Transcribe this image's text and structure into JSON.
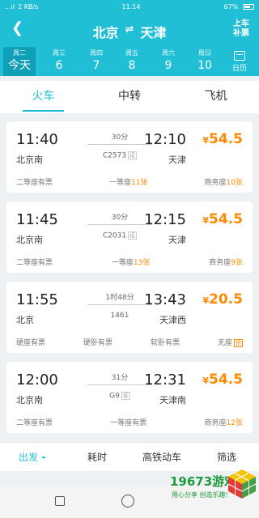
{
  "statusbar": {
    "signal": "...ıl",
    "speed": "2 KB/s",
    "time": "11:14",
    "battery": "67%"
  },
  "header": {
    "from": "北京",
    "to": "天津",
    "swap": "⇌",
    "bupiao": "上车补票"
  },
  "dates": [
    {
      "week": "周二",
      "day": "今天",
      "selected": true
    },
    {
      "week": "周三",
      "day": "6"
    },
    {
      "week": "周四",
      "day": "7"
    },
    {
      "week": "周五",
      "day": "8"
    },
    {
      "week": "周六",
      "day": "9"
    },
    {
      "week": "周日",
      "day": "10"
    }
  ],
  "calendar_label": "日历",
  "tabs": [
    "火车",
    "中转",
    "飞机"
  ],
  "trains": [
    {
      "dep_time": "11:40",
      "dep_station": "北京南",
      "duration": "30分",
      "train_no": "C2573",
      "arr_time": "12:10",
      "arr_station": "天津",
      "price": "54.5",
      "seats": [
        {
          "label": "二等座",
          "value": "有票"
        },
        {
          "label": "一等座",
          "value": "11张"
        },
        {
          "label": "商务座",
          "value": "10张"
        }
      ]
    },
    {
      "dep_time": "11:45",
      "dep_station": "北京南",
      "duration": "30分",
      "train_no": "C2031",
      "arr_time": "12:15",
      "arr_station": "天津",
      "price": "54.5",
      "seats": [
        {
          "label": "二等座",
          "value": "有票"
        },
        {
          "label": "一等座",
          "value": "13张"
        },
        {
          "label": "商务座",
          "value": "9张"
        }
      ]
    },
    {
      "dep_time": "11:55",
      "dep_station": "北京",
      "duration": "1时48分",
      "train_no": "1461",
      "arr_time": "13:43",
      "arr_station": "天津西",
      "price": "20.5",
      "seats": [
        {
          "label": "硬座",
          "value": "有票"
        },
        {
          "label": "硬卧",
          "value": "有票"
        },
        {
          "label": "软卧",
          "value": "有票"
        },
        {
          "label": "无座",
          "value": "抢"
        }
      ]
    },
    {
      "dep_time": "12:00",
      "dep_station": "北京南",
      "duration": "31分",
      "train_no": "G9",
      "arr_time": "12:31",
      "arr_station": "天津南",
      "price": "54.5",
      "seats": [
        {
          "label": "二等座",
          "value": "有票"
        },
        {
          "label": "一等座",
          "value": "有票"
        },
        {
          "label": "商务座",
          "value": "12张"
        }
      ]
    }
  ],
  "id_badge": "证",
  "yen": "¥",
  "bottombar": [
    {
      "label": "出发",
      "active": true,
      "arrow": "⏶"
    },
    {
      "label": "耗时"
    },
    {
      "label": "高铁动车"
    },
    {
      "label": "筛选"
    }
  ],
  "watermark": {
    "title": "19673游戏",
    "sub": "用心分享 创造乐趣!"
  },
  "accent_color": "#21bfd6",
  "price_color": "#ff8a00"
}
